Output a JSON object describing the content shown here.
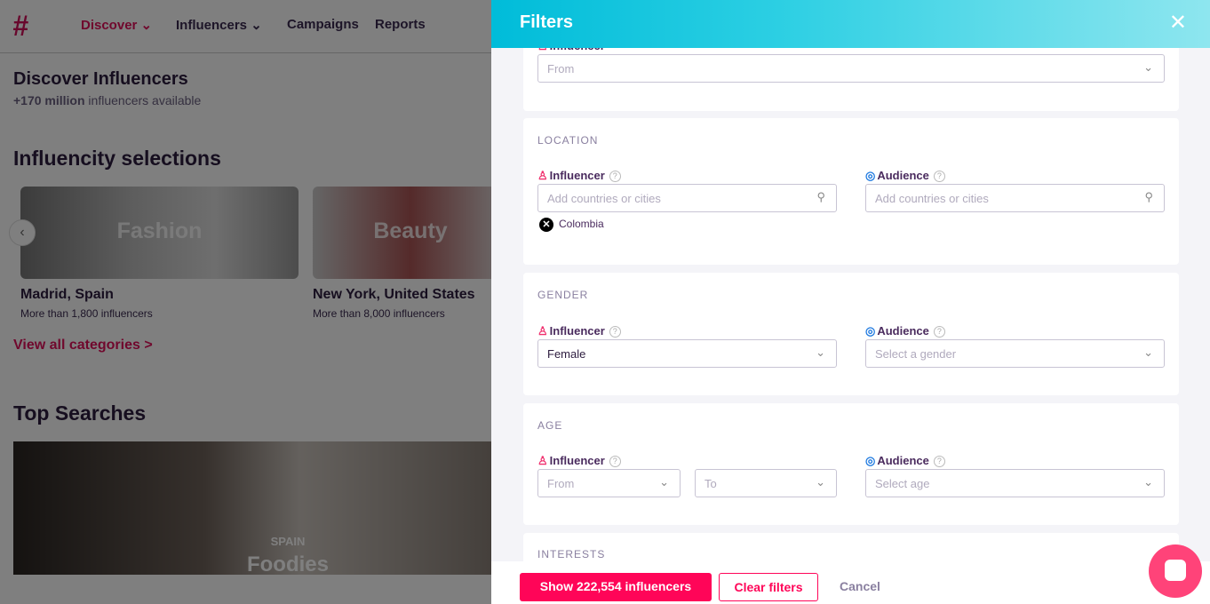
{
  "nav": {
    "discover": "Discover",
    "influencers": "Influencers",
    "campaigns": "Campaigns",
    "reports": "Reports"
  },
  "page": {
    "title": "Discover Influencers",
    "subtitle_bold": "+170 million",
    "subtitle_rest": " influencers available",
    "selections_title": "Influencity selections",
    "view_all": "View all categories >",
    "top_searches": "Top Searches"
  },
  "selections": [
    {
      "image_label": "Fashion",
      "title": "Madrid, Spain",
      "subtitle": "More than 1,800 influencers"
    },
    {
      "image_label": "Beauty",
      "title": "New York, United States",
      "subtitle": "More than 8,000 influencers"
    }
  ],
  "top_search": {
    "country": "SPAIN",
    "category": "Foodies"
  },
  "filters": {
    "title": "Filters",
    "partial": {
      "label": "Influencer",
      "placeholder": "From"
    },
    "location": {
      "section": "LOCATION",
      "influencer_label": "Influencer",
      "audience_label": "Audience",
      "influencer_placeholder": "Add countries or cities",
      "audience_placeholder": "Add countries or cities",
      "chips": [
        "Colombia"
      ]
    },
    "gender": {
      "section": "GENDER",
      "influencer_label": "Influencer",
      "audience_label": "Audience",
      "influencer_value": "Female",
      "audience_placeholder": "Select a gender"
    },
    "age": {
      "section": "AGE",
      "influencer_label": "Influencer",
      "audience_label": "Audience",
      "from_placeholder": "From",
      "to_placeholder": "To",
      "audience_placeholder": "Select age"
    },
    "interests": {
      "section": "INTERESTS"
    },
    "footer": {
      "show": "Show  222,554  influencers",
      "clear": "Clear filters",
      "cancel": "Cancel"
    }
  },
  "colors": {
    "accent": "#ff0558",
    "header_start": "#00bcd9",
    "header_end": "#8ee6ef",
    "audience": "#1f7ae0"
  }
}
